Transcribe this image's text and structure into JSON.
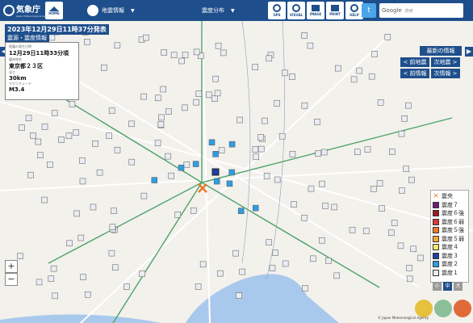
{
  "header": {
    "logo_text": "気象庁",
    "logo_sub": "Japan Meteorological Agency",
    "home_label": "HOME",
    "menu1": "地震情報",
    "menu2": "震度分布",
    "tools": [
      "GPS",
      "VISUAL",
      "IMAGE",
      "PRINT",
      "HELP"
    ],
    "twitter": "t",
    "search_brand": "Google",
    "search_placeholder": "検索"
  },
  "banner": {
    "title": "2023年12月29日11時37分発表",
    "subtitle": "震源・震度情報"
  },
  "info_panel": {
    "time_label": "地震の発生日時",
    "time": "12月29日11時33分頃",
    "place_label": "震央地名",
    "place": "東京都２３区",
    "depth_label": "深さ",
    "depth": "30km",
    "mag_label": "マグニチュード",
    "mag": "M3.4"
  },
  "nav": {
    "latest": "最新の情報",
    "prev_quake": "< 前地震",
    "next_quake": "次地震 >",
    "prev_info": "< 前情報",
    "next_info": "次情報 >"
  },
  "legend": {
    "items": [
      {
        "label": "震央",
        "color": "#ffffff",
        "mark": "×"
      },
      {
        "label": "震度７",
        "color": "#6f1b7a",
        "mark": ""
      },
      {
        "label": "震度６強",
        "color": "#9d1a1f",
        "mark": ""
      },
      {
        "label": "震度６弱",
        "color": "#d93a34",
        "mark": ""
      },
      {
        "label": "震度５強",
        "color": "#e8792b",
        "mark": ""
      },
      {
        "label": "震度５弱",
        "color": "#f1a83a",
        "mark": ""
      },
      {
        "label": "震度４",
        "color": "#f5e86a",
        "mark": ""
      },
      {
        "label": "震度３",
        "color": "#1f3fa3",
        "mark": ""
      },
      {
        "label": "震度２",
        "color": "#2f9ee0",
        "mark": ""
      },
      {
        "label": "震度１",
        "color": "#e9edf1",
        "mark": ""
      }
    ],
    "size_buttons": [
      "小",
      "中",
      "大"
    ]
  },
  "zoom": {
    "plus": "+",
    "minus": "−"
  },
  "attribution": "© Japan Meteorological Agency",
  "colors": {
    "brand": "#1e4f8c",
    "shindo2": "#2f9ee0",
    "shindo1": "#e9edf1",
    "shindo3": "#1f3fa3",
    "epicenter": "#e8792b"
  }
}
